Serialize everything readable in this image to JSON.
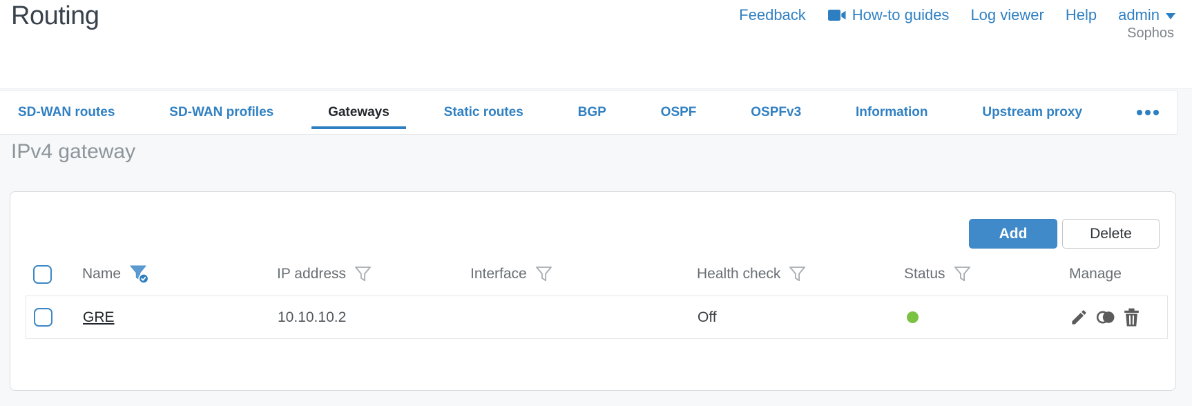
{
  "header": {
    "title": "Routing",
    "nav": {
      "feedback": "Feedback",
      "howto": "How-to guides",
      "log_viewer": "Log viewer",
      "help": "Help",
      "user": "admin"
    },
    "brand": "Sophos"
  },
  "tabs": {
    "items": [
      {
        "label": "SD-WAN routes",
        "active": false
      },
      {
        "label": "SD-WAN profiles",
        "active": false
      },
      {
        "label": "Gateways",
        "active": true
      },
      {
        "label": "Static routes",
        "active": false
      },
      {
        "label": "BGP",
        "active": false
      },
      {
        "label": "OSPF",
        "active": false
      },
      {
        "label": "OSPFv3",
        "active": false
      },
      {
        "label": "Information",
        "active": false
      },
      {
        "label": "Upstream proxy",
        "active": false
      }
    ],
    "overflow_icon": "ellipsis-menu"
  },
  "section": {
    "title": "IPv4 gateway"
  },
  "toolbar": {
    "add_label": "Add",
    "delete_label": "Delete"
  },
  "table": {
    "columns": [
      {
        "label": "Name",
        "filter": "active"
      },
      {
        "label": "IP address",
        "filter": "default"
      },
      {
        "label": "Interface",
        "filter": "default"
      },
      {
        "label": "Health check",
        "filter": "default"
      },
      {
        "label": "Status",
        "filter": "default"
      },
      {
        "label": "Manage",
        "filter": "none"
      }
    ],
    "rows": [
      {
        "name": "GRE",
        "ip_address": "10.10.10.2",
        "interface": "",
        "health_check": "Off",
        "status": "green"
      }
    ]
  },
  "colors": {
    "accent_blue": "#3080c2",
    "tab_underline_blue": "#2e7fc1",
    "button_blue": "#418aca",
    "status_green": "#7cc242",
    "title_gray": "#39424c",
    "section_title_gray": "#8d959b"
  }
}
